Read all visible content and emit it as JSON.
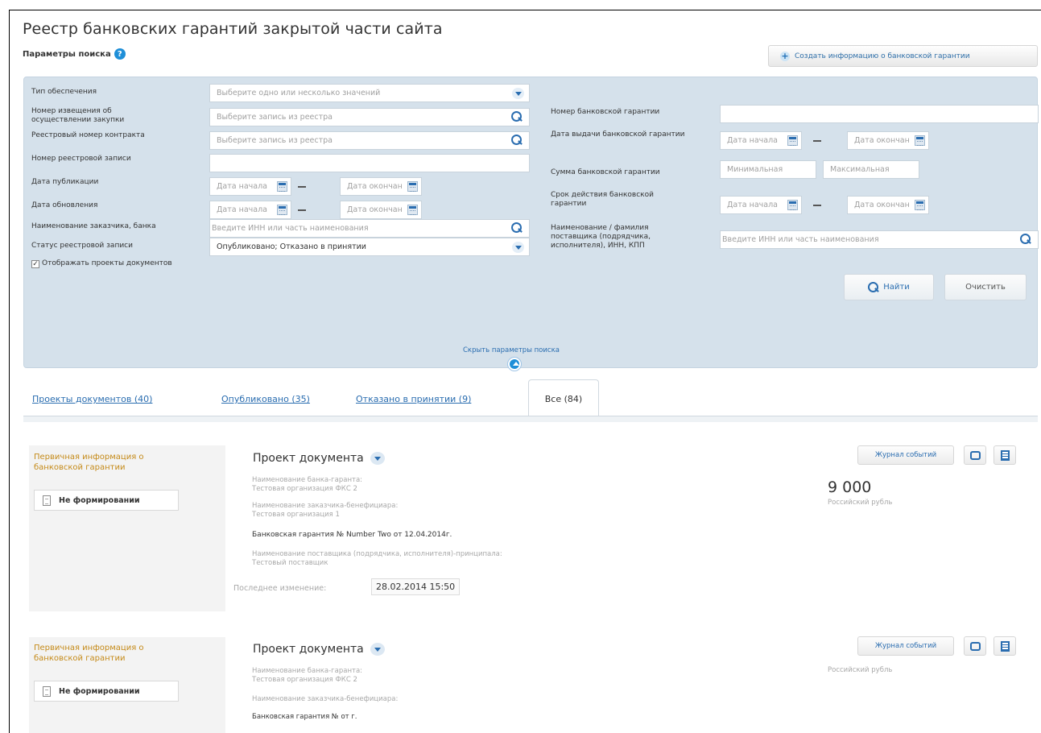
{
  "page": {
    "title": "Реестр банковских гарантий закрытой части сайта",
    "params_label": "Параметры поиска",
    "create_button": "Создать информацию о банковской гарантии"
  },
  "filters": {
    "left": [
      {
        "label": "Тип обеспечения",
        "placeholder": "Выберите одно или несколько значений",
        "control": "dropdown"
      },
      {
        "label": "Номер извещения об осуществлении закупки",
        "placeholder": "Выберите запись из реестра",
        "control": "search"
      },
      {
        "label": "Реестровый номер контракта",
        "placeholder": "Выберите запись из реестра",
        "control": "search"
      },
      {
        "label": "Номер реестровой записи",
        "placeholder": "",
        "control": "text"
      },
      {
        "label": "Дата публикации",
        "start": "Дата начала",
        "end": "Дата окончан",
        "control": "daterange"
      },
      {
        "label": "Дата обновления",
        "start": "Дата начала",
        "end": "Дата окончан",
        "control": "daterange"
      },
      {
        "label": "Наименование заказчика, банка",
        "placeholder": "Введите ИНН или часть наименования",
        "control": "search"
      },
      {
        "label": "Статус реестровой записи",
        "value": "Опубликовано; Отказано в принятии",
        "control": "dropdown"
      }
    ],
    "right": {
      "guarantee_number": {
        "label": "Номер банковской гарантии",
        "placeholder": ""
      },
      "issue_date": {
        "label": "Дата выдачи банковской гарантии",
        "start": "Дата начала",
        "end": "Дата окончан"
      },
      "amount": {
        "label": "Сумма банковской гарантии",
        "min": "Минимальная",
        "max": "Максимальная"
      },
      "validity": {
        "label": "Срок действия банковской гарантии",
        "start": "Дата начала",
        "end": "Дата окончан"
      },
      "supplier": {
        "label": "Наименование / фамилия поставщика (подрядчика, исполнителя), ИНН, КПП",
        "placeholder": "Введите ИНН или часть наименования"
      }
    },
    "show_drafts_label": "Отображать проекты документов",
    "show_drafts_checked": true,
    "find_button": "Найти",
    "clear_button": "Очистить",
    "hide_params_link": "Скрыть параметры поиска"
  },
  "tabs": [
    {
      "label": "Проекты документов (40)",
      "active": false
    },
    {
      "label": "Опубликовано (35)",
      "active": false
    },
    {
      "label": "Отказано в принятии (9)",
      "active": false
    },
    {
      "label": "Все (84)",
      "active": true
    }
  ],
  "cards": [
    {
      "section_title": "Первичная информация о банковской гарантии",
      "status": "Не формировании",
      "doc_type": "Проект документа",
      "bank_label": "Наименование банка-гаранта:",
      "bank_value": "Тестовая организация ФКС 2",
      "customer_label": "Наименование заказчика-бенефициара:",
      "customer_value": "Тестовая организация 1",
      "guarantee_line": "Банковская гарантия № Number Two от 12.04.2014г.",
      "supplier_label": "Наименование поставщика (подрядчика, исполнителя)-принципала:",
      "supplier_value": "Тестовый поставщик",
      "last_change_label": "Последнее изменение:",
      "last_change_value": "28.02.2014 15:50",
      "journal_button": "Журнал событий",
      "amount": "9 000",
      "currency": "Российский рубль"
    },
    {
      "section_title": "Первичная информация о банковской гарантии",
      "status": "Не формировании",
      "doc_type": "Проект документа",
      "bank_label": "Наименование банка-гаранта:",
      "bank_value": "Тестовая организация ФКС 2",
      "customer_label": "Наименование заказчика-бенефициара:",
      "guarantee_line": "Банковская гарантия № от г.",
      "journal_button": "Журнал событий",
      "currency": "Российский рубль"
    }
  ]
}
